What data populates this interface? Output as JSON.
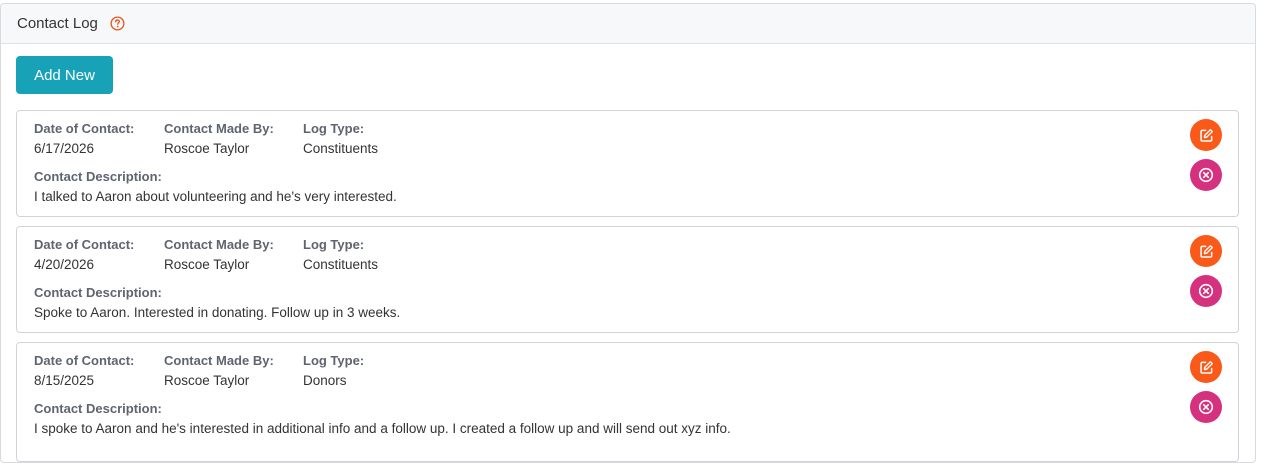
{
  "panel": {
    "title": "Contact Log",
    "help_icon": "question-circle-icon",
    "add_button_label": "Add New"
  },
  "labels": {
    "date": "Date of Contact:",
    "made_by": "Contact Made By:",
    "log_type": "Log Type:",
    "description": "Contact Description:"
  },
  "entries": [
    {
      "date": "6/17/2026",
      "made_by": "Roscoe Taylor",
      "log_type": "Constituents",
      "description": "I talked to Aaron about volunteering and he's very interested."
    },
    {
      "date": "4/20/2026",
      "made_by": "Roscoe Taylor",
      "log_type": "Constituents",
      "description": "Spoke to Aaron. Interested in donating. Follow up in 3 weeks."
    },
    {
      "date": "8/15/2025",
      "made_by": "Roscoe Taylor",
      "log_type": "Donors",
      "description": "I spoke to Aaron and he's interested in additional info and a follow up. I created a follow up and will send out xyz info."
    }
  ],
  "icons": {
    "edit": "edit-icon",
    "delete": "delete-circle-x-icon"
  },
  "colors": {
    "primary_button": "#17a2b8",
    "edit_button": "#f95919",
    "delete_button": "#d6317e",
    "help_icon": "#e8541e"
  }
}
